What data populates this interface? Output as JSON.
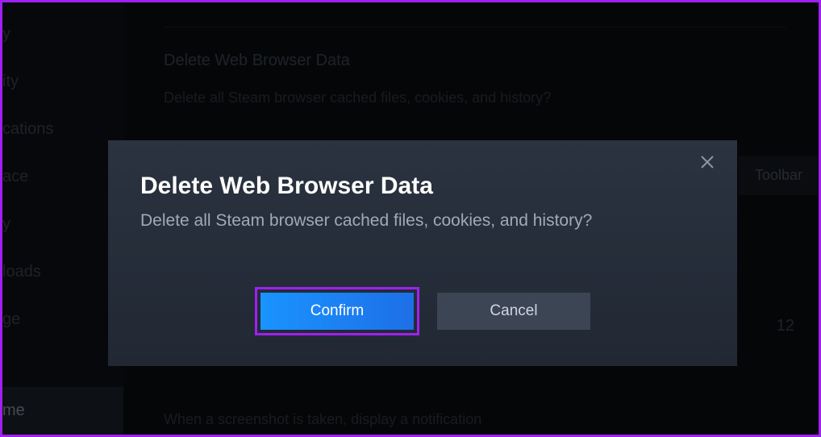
{
  "sidebar": {
    "items": [
      {
        "label": "y"
      },
      {
        "label": "ity"
      },
      {
        "label": "cations"
      },
      {
        "label": "ace"
      },
      {
        "label": "y"
      },
      {
        "label": "loads"
      },
      {
        "label": "ge"
      },
      {
        "label": "me"
      }
    ]
  },
  "content": {
    "section_title": "Delete Web Browser Data",
    "section_desc": "Delete all Steam browser cached files, cookies, and history?",
    "toolbar_label": "Toolbar",
    "screenshot_label": "When a screenshot is taken, display a notification",
    "badge_value": "12"
  },
  "modal": {
    "title": "Delete Web Browser Data",
    "desc": "Delete all Steam browser cached files, cookies, and history?",
    "confirm_label": "Confirm",
    "cancel_label": "Cancel"
  }
}
